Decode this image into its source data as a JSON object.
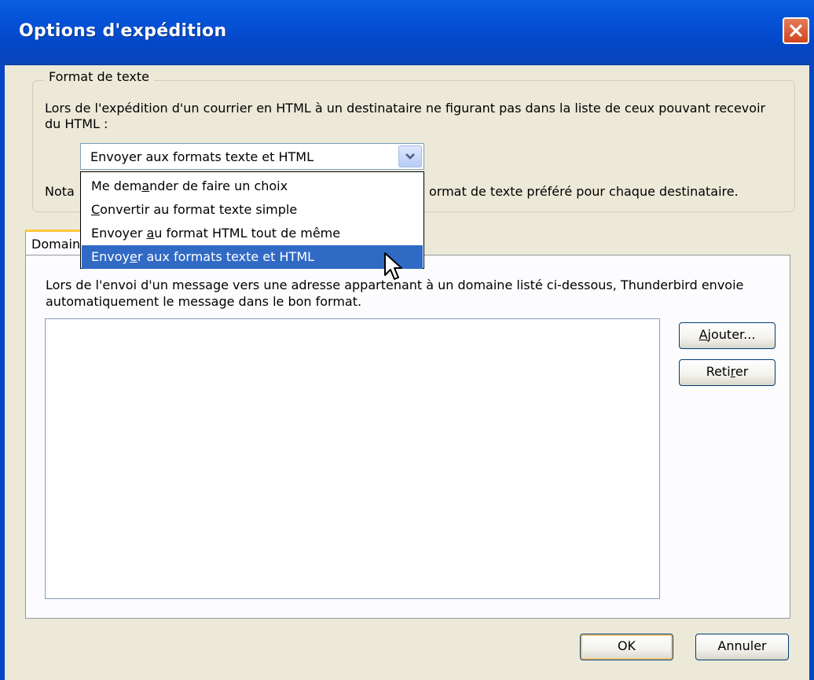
{
  "window": {
    "title": "Options d'expédition"
  },
  "text_format": {
    "legend": "Format de texte",
    "description": "Lors de l'expédition d'un courrier en HTML à un destinataire ne figurant pas dans la liste de ceux pouvant recevoir du HTML :",
    "combo_selected": "Envoyer aux formats texte et HTML",
    "note_left": "Nota",
    "note_right": "ormat de texte préféré pour chaque destinataire.",
    "options": [
      {
        "before": "Me dem",
        "key": "a",
        "after": "nder de faire un choix",
        "selected": false
      },
      {
        "before": "",
        "key": "C",
        "after": "onvertir au format texte simple",
        "selected": false
      },
      {
        "before": "Envoyer ",
        "key": "a",
        "after": "u format HTML tout de même",
        "selected": false
      },
      {
        "before": "Envoy",
        "key": "e",
        "after": "r aux formats texte et HTML",
        "selected": true
      }
    ]
  },
  "tabs": {
    "active_label": "Domaines"
  },
  "domains": {
    "description": "Lors de l'envoi d'un message vers une adresse appartenant à un domaine listé ci-dessous, Thunderbird envoie automatiquement le message dans le bon format.",
    "add_button": {
      "key": "A",
      "after": "jouter..."
    },
    "remove_button": {
      "before": "Reti",
      "key": "r",
      "after": "er"
    }
  },
  "footer": {
    "ok_label": "OK",
    "cancel_label": "Annuler"
  },
  "colors": {
    "titlebar": "#0553d8",
    "highlight": "#316ac5",
    "dialog_bg": "#ece9d8"
  },
  "icons": {
    "close": "close-icon",
    "combo_arrow": "chevron-down-icon",
    "cursor": "mouse-pointer-icon"
  }
}
